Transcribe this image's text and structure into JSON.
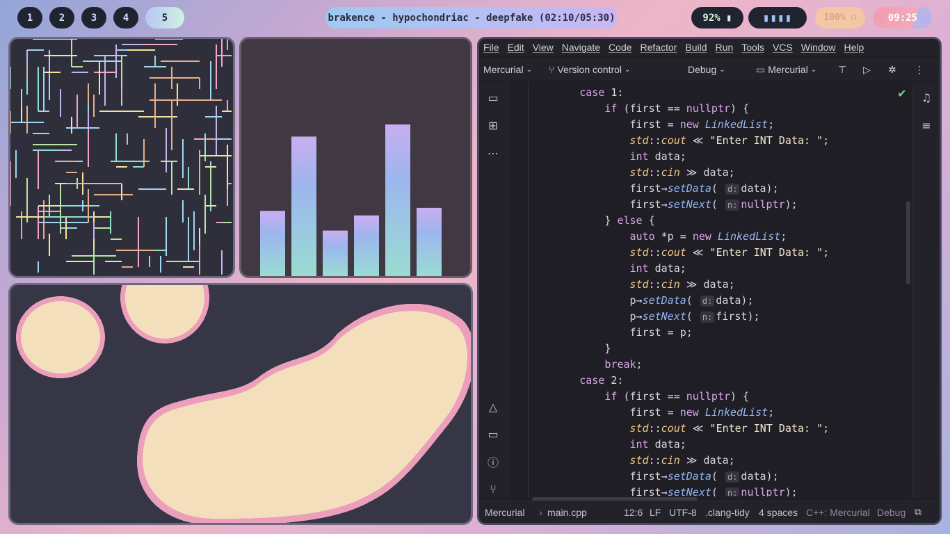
{
  "bar": {
    "workspaces": [
      "1",
      "2",
      "3",
      "4",
      "5"
    ],
    "active_workspace": "5",
    "window_title": "brakence - hypochondriac - deepfake (02:10/05:30)",
    "battery": "92% ▮",
    "volume": "100% ☊",
    "clock": "09:25",
    "visualizer": "▮▮▮▮"
  },
  "bars_panel": {
    "values": [
      0.43,
      0.92,
      0.3,
      0.4,
      1.0,
      0.45
    ]
  },
  "ide": {
    "menu": [
      "File",
      "Edit",
      "View",
      "Navigate",
      "Code",
      "Refactor",
      "Build",
      "Run",
      "Tools",
      "VCS",
      "Window",
      "Help"
    ],
    "project": "Mercurial",
    "vcs": "Version control",
    "config": "Debug",
    "run_target": "Mercurial",
    "status": {
      "project": "Mercurial",
      "file": "main.cpp",
      "position": "12:6",
      "line_sep": "LF",
      "encoding": "UTF-8",
      "linter": ".clang-tidy",
      "indent": "4 spaces",
      "context": "C++: Mercurial",
      "config": "Debug"
    }
  },
  "code_lines": [
    "        case 1:",
    "            if (first == nullptr) {",
    "                first = new LinkedList;",
    "                std::cout << \"Enter INT Data: \";",
    "                int data;",
    "                std::cin >> data;",
    "                first->setData( d: data);",
    "                first->setNext( n: nullptr);",
    "            } else {",
    "                auto *p = new LinkedList;",
    "                std::cout << \"Enter INT Data: \";",
    "                int data;",
    "                std::cin >> data;",
    "                p->setData( d: data);",
    "                p->setNext( n: first);",
    "                first = p;",
    "            }",
    "            break;",
    "        case 2:",
    "            if (first == nullptr) {",
    "                first = new LinkedList;",
    "                std::cout << \"Enter INT Data: \";",
    "                int data;",
    "                std::cin >> data;",
    "                first->setData( d: data);",
    "                first->setNext( n: nullptr);",
    "            }"
  ]
}
